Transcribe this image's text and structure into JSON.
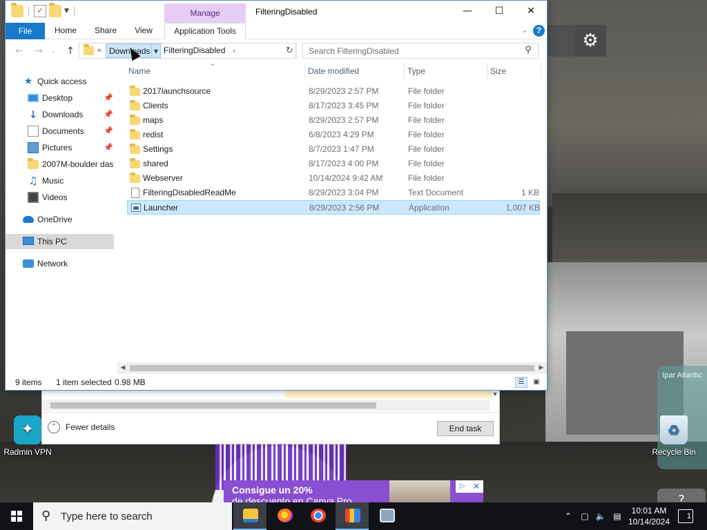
{
  "desktop": {
    "icons": [
      {
        "label": "Radmin VPN"
      },
      {
        "label": "Recycle Bin"
      }
    ],
    "side_widget_text": "Ipar Atlantic",
    "help_glyph": "?",
    "ad": {
      "line1": "Consigue un 20%",
      "line2": "de descuento en Canva Pro"
    }
  },
  "task_manager": {
    "fewer_details": "Fewer details",
    "end_task": "End task"
  },
  "explorer": {
    "manage_label": "Manage",
    "title": "FilteringDisabled",
    "ribbon": {
      "file": "File",
      "home": "Home",
      "share": "Share",
      "view": "View",
      "app_tools": "Application Tools"
    },
    "address": {
      "chevron": "«",
      "parent": "Downloads",
      "current": "FilteringDisabled"
    },
    "search": {
      "placeholder": "Search FilteringDisabled"
    },
    "nav": [
      {
        "label": "Quick access",
        "icon": "star-icon"
      },
      {
        "label": "Desktop",
        "icon": "desktop-icon",
        "pinned": true
      },
      {
        "label": "Downloads",
        "icon": "download-icon",
        "pinned": true
      },
      {
        "label": "Documents",
        "icon": "documents-icon",
        "pinned": true
      },
      {
        "label": "Pictures",
        "icon": "pictures-icon",
        "pinned": true
      },
      {
        "label": "2007M-boulder das",
        "icon": "folder-icon"
      },
      {
        "label": "Music",
        "icon": "music-icon"
      },
      {
        "label": "Videos",
        "icon": "videos-icon"
      },
      {
        "label": "OneDrive",
        "icon": "cloud-icon"
      },
      {
        "label": "This PC",
        "icon": "computer-icon",
        "selected": true
      },
      {
        "label": "Network",
        "icon": "network-icon"
      }
    ],
    "columns": {
      "name": "Name",
      "date": "Date modified",
      "type": "Type",
      "size": "Size"
    },
    "files": [
      {
        "name": "2017launchsource",
        "date": "8/29/2023 2:57 PM",
        "type": "File folder",
        "size": "",
        "icon": "folder-icon"
      },
      {
        "name": "Clients",
        "date": "8/17/2023 3:45 PM",
        "type": "File folder",
        "size": "",
        "icon": "folder-icon"
      },
      {
        "name": "maps",
        "date": "8/29/2023 2:57 PM",
        "type": "File folder",
        "size": "",
        "icon": "folder-icon"
      },
      {
        "name": "redist",
        "date": "6/8/2023 4:29 PM",
        "type": "File folder",
        "size": "",
        "icon": "folder-icon"
      },
      {
        "name": "Settings",
        "date": "8/7/2023 1:47 PM",
        "type": "File folder",
        "size": "",
        "icon": "folder-icon"
      },
      {
        "name": "shared",
        "date": "8/17/2023 4:00 PM",
        "type": "File folder",
        "size": "",
        "icon": "folder-icon"
      },
      {
        "name": "Webserver",
        "date": "10/14/2024 9:42 AM",
        "type": "File folder",
        "size": "",
        "icon": "folder-icon"
      },
      {
        "name": "FilteringDisabledReadMe",
        "date": "8/29/2023 3:04 PM",
        "type": "Text Document",
        "size": "1 KB",
        "icon": "text-document-icon"
      },
      {
        "name": "Launcher",
        "date": "8/29/2023 2:56 PM",
        "type": "Application",
        "size": "1,007 KB",
        "icon": "application-icon",
        "selected": true
      }
    ],
    "status": {
      "count": "9 items",
      "selection": "1 item selected",
      "size": "0.98 MB"
    }
  },
  "taskbar": {
    "search_placeholder": "Type here to search",
    "time": "10:01 AM",
    "date": "10/14/2024",
    "notifications": "1"
  }
}
